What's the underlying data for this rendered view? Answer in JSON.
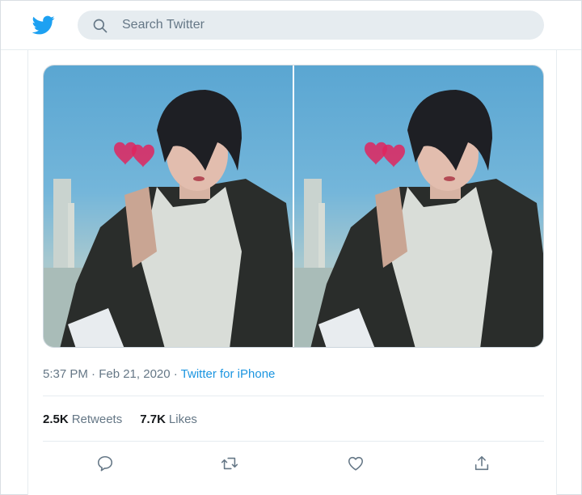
{
  "header": {
    "logo_icon": "twitter-bird-icon",
    "search": {
      "placeholder": "Search Twitter",
      "icon": "search-icon"
    }
  },
  "tweet": {
    "photos": [
      {
        "alt": "photo-1"
      },
      {
        "alt": "photo-2"
      }
    ],
    "timestamp": "5:37 PM · Feb 21, 2020 · ",
    "source": "Twitter for iPhone",
    "stats": {
      "retweets_count": "2.5K",
      "retweets_label": "Retweets",
      "likes_count": "7.7K",
      "likes_label": "Likes"
    },
    "actions": [
      "reply-icon",
      "retweet-icon",
      "like-icon",
      "share-icon"
    ]
  },
  "colors": {
    "brand": "#1da1f2",
    "link": "#1b95e0",
    "secondary_text": "#657786",
    "search_bg": "#e6ecf0",
    "heart": "#e0245e"
  }
}
